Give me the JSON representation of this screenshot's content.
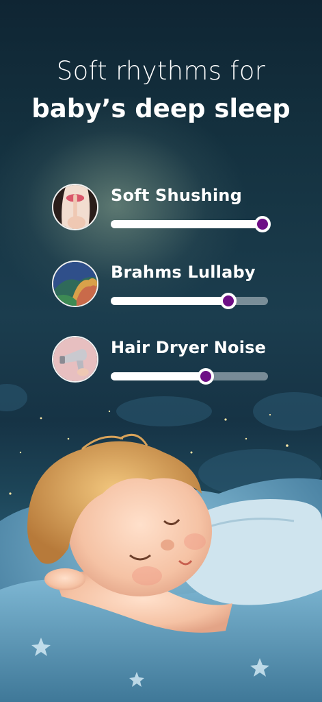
{
  "headline": {
    "line1": "Soft rhythms for",
    "line2": "baby’s deep sleep"
  },
  "tracks": [
    {
      "title": "Soft Shushing",
      "icon": "shushing-lips-icon",
      "volume": 1.0
    },
    {
      "title": "Brahms Lullaby",
      "icon": "painted-hills-icon",
      "volume": 0.77
    },
    {
      "title": "Hair Dryer Noise",
      "icon": "hair-dryer-icon",
      "volume": 0.62
    }
  ],
  "colors": {
    "knob": "#6e0f86",
    "fill": "#ffffff",
    "rail": "#c8d2d7"
  },
  "illustration": "sleeping-baby-illustration"
}
